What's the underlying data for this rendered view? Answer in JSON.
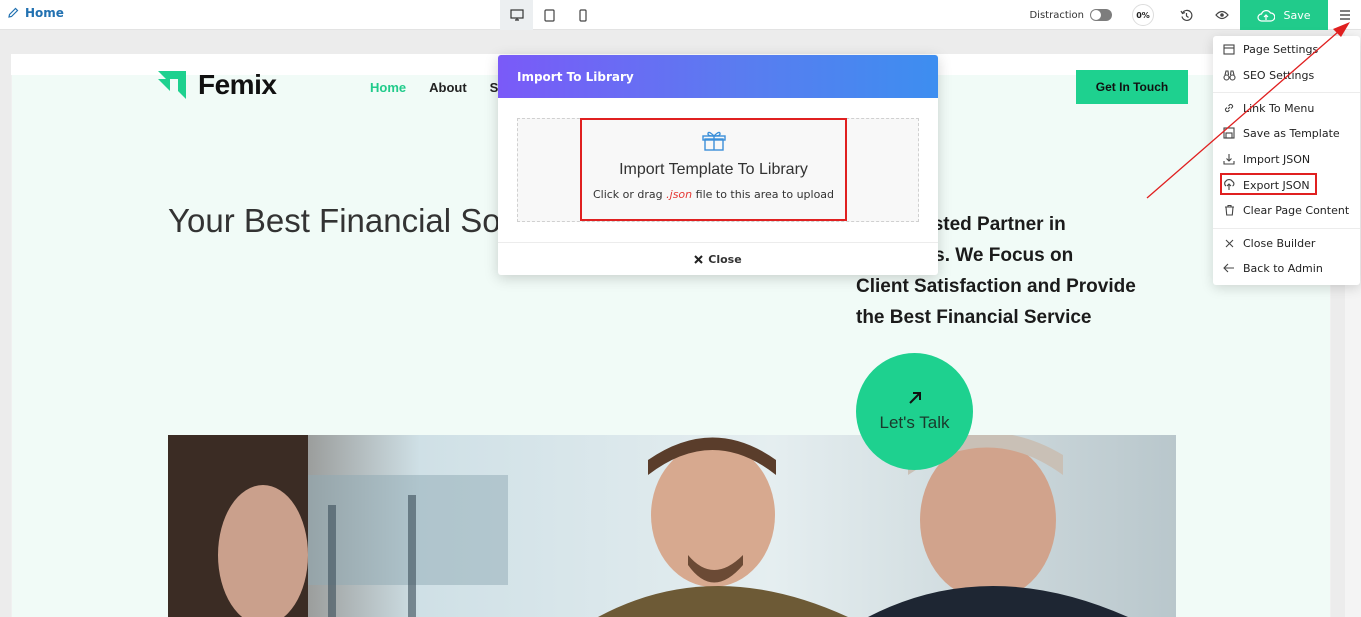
{
  "topbar": {
    "home_label": "Home",
    "devices": [
      "desktop-icon",
      "tablet-icon",
      "mobile-icon"
    ],
    "active_device": "desktop",
    "distraction_label": "Distraction",
    "distraction_on": false,
    "progress": "0%",
    "save_label": "Save",
    "accent": "#21cb8b"
  },
  "site": {
    "logo_text": "Femix",
    "nav": [
      {
        "label": "Home",
        "active": true
      },
      {
        "label": "About",
        "active": false
      },
      {
        "label": "S",
        "active": false
      }
    ],
    "cta_label": "Get In Touch",
    "hero_title": "Your Best Financial So",
    "hero_text": "Your Trusted Partner in . Services. We Focus on Client Satisfaction and Provide the Best Financial Service",
    "hero_text_lines": [
      "Your Trusted Partner in",
      ". Services. We Focus on",
      "Client Satisfaction and Provide",
      "the Best Financial Service"
    ],
    "talk_label": "Let's Talk",
    "brand_color": "#1ed18f"
  },
  "modal": {
    "title": "Import To Library",
    "dropzone_title": "Import Template To Library",
    "dropzone_prefix": "Click or drag",
    "dropzone_ext": ".json",
    "dropzone_suffix": "file to this area to upload",
    "close_label": "Close"
  },
  "menu": {
    "items": [
      {
        "label": "Page Settings",
        "icon": "page-settings-icon"
      },
      {
        "label": "SEO Settings",
        "icon": "binoculars-icon"
      },
      {
        "label": "Link To Menu",
        "icon": "link-icon"
      },
      {
        "label": "Save as Template",
        "icon": "save-template-icon"
      },
      {
        "label": "Import JSON",
        "icon": "import-icon"
      },
      {
        "label": "Export JSON",
        "icon": "export-icon",
        "highlighted": true
      },
      {
        "label": "Clear Page Content",
        "icon": "trash-icon"
      },
      {
        "label": "Close Builder",
        "icon": "close-icon"
      },
      {
        "label": "Back to Admin",
        "icon": "arrow-left-icon"
      }
    ]
  },
  "annotation_color": "#e02020"
}
